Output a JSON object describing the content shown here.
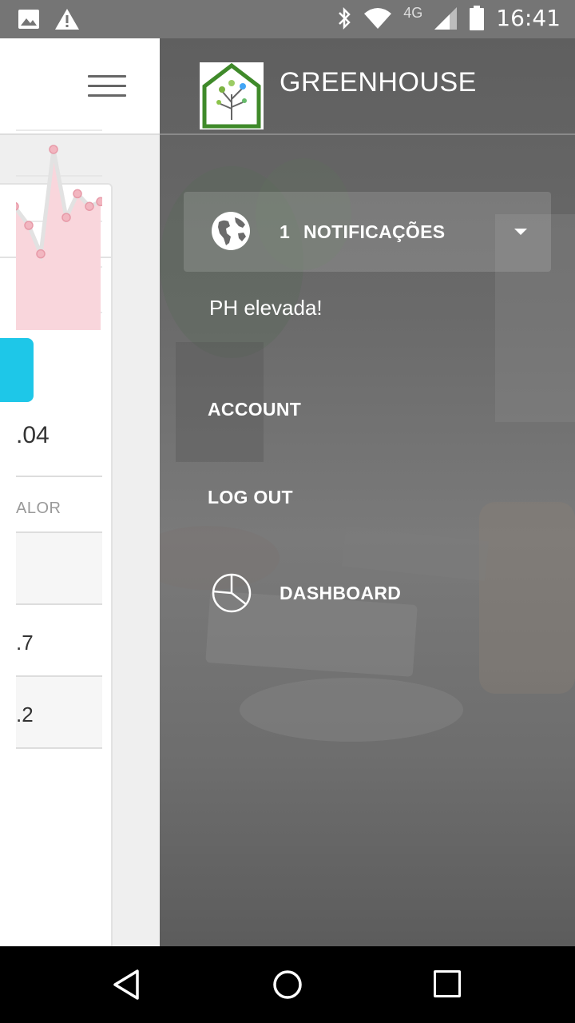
{
  "status_bar": {
    "network": "4G",
    "time": "16:41",
    "icons": [
      "image-icon",
      "warning-icon",
      "bluetooth-icon",
      "wifi-icon",
      "signal-icon",
      "battery-icon"
    ]
  },
  "main": {
    "big_value": ".04",
    "table": {
      "header": "ALOR",
      "rows": [
        "",
        ".7",
        ".2"
      ]
    },
    "chart_data": {
      "type": "area",
      "note_color": "#f7c8d0",
      "values": [
        0.62,
        0.5,
        0.32,
        0.98,
        0.55,
        0.7,
        0.62,
        0.65
      ]
    }
  },
  "drawer": {
    "brand": "GREENHOUSE",
    "notifications": {
      "count": "1",
      "label": "NOTIFICAÇÕES",
      "message": "PH elevada!"
    },
    "menu": {
      "account": "ACCOUNT",
      "logout": "LOG OUT",
      "dashboard": "DASHBOARD"
    }
  },
  "colors": {
    "accent_blue": "#1ec7e8",
    "logo_green": "#3f8a2a",
    "status_bar": "#757575"
  }
}
